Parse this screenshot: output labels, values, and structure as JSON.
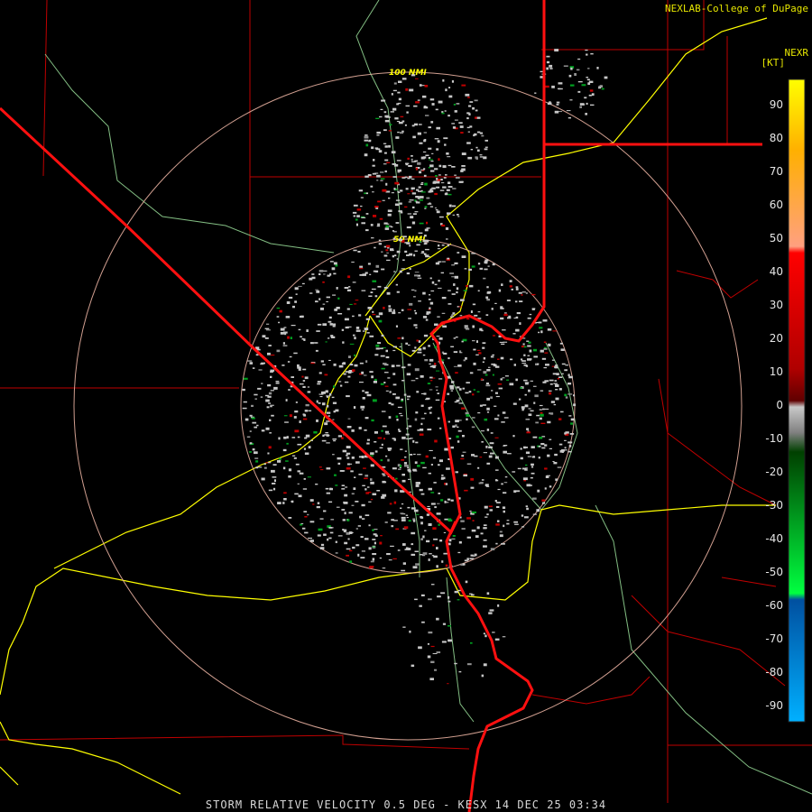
{
  "header": {
    "credit": "NEXLAB-College of DuPage",
    "product_code": "NEXR",
    "units": "[KT]"
  },
  "caption": "STORM RELATIVE VELOCITY 0.5 DEG - KESX 14 DEC 25 03:34",
  "rings": [
    {
      "label": "50 NMI"
    },
    {
      "label": "100 NMI"
    }
  ],
  "legend": {
    "ticks": [
      "90",
      "80",
      "70",
      "60",
      "50",
      "40",
      "30",
      "20",
      "10",
      "0",
      "-10",
      "-20",
      "-30",
      "-40",
      "-50",
      "-60",
      "-70",
      "-80",
      "-90"
    ]
  },
  "colors": {
    "background": "#000000",
    "state_border": "#ff0000",
    "county_line": "#c8ffc8",
    "highway": "#ffff00",
    "range_ring": "#e8b0a0",
    "text": "#ffff00"
  }
}
